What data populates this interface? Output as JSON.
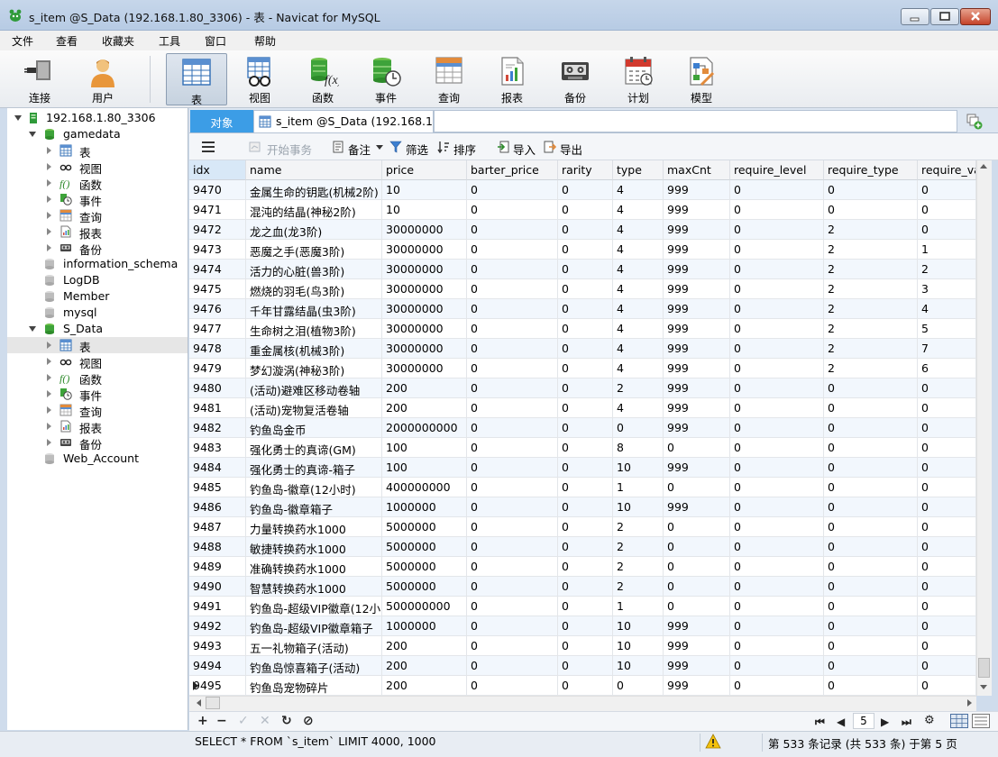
{
  "window": {
    "title": "s_item @S_Data (192.168.1.80_3306) - 表 - Navicat for MySQL"
  },
  "menu": [
    "文件",
    "查看",
    "收藏夹",
    "工具",
    "窗口",
    "帮助"
  ],
  "toolbar": {
    "connect": "连接",
    "user": "用户",
    "table": "表",
    "view": "视图",
    "function": "函数",
    "event": "事件",
    "query": "查询",
    "report": "报表",
    "backup": "备份",
    "schedule": "计划",
    "model": "模型"
  },
  "tree": {
    "connection": "192.168.1.80_3306",
    "gamedata": {
      "name": "gamedata",
      "children": [
        "表",
        "视图",
        "函数",
        "事件",
        "查询",
        "报表",
        "备份"
      ]
    },
    "databases": [
      "information_schema",
      "LogDB",
      "Member",
      "mysql"
    ],
    "s_data": {
      "name": "S_Data",
      "children": [
        "表",
        "视图",
        "函数",
        "事件",
        "查询",
        "报表",
        "备份"
      ]
    },
    "web_account": "Web_Account"
  },
  "tabs": {
    "objects": "对象",
    "item": "s_item @S_Data (192.168.1...."
  },
  "gridtoolbar": {
    "begin_tx": "开始事务",
    "memo": "备注",
    "filter": "筛选",
    "sort": "排序",
    "import": "导入",
    "export": "导出"
  },
  "columns": [
    "idx",
    "name",
    "price",
    "barter_price",
    "rarity",
    "type",
    "maxCnt",
    "require_level",
    "require_type",
    "require_va"
  ],
  "rows": [
    [
      "9470",
      "金属生命的钥匙(机械2阶)",
      "10",
      "0",
      "0",
      "4",
      "999",
      "0",
      "0",
      "0"
    ],
    [
      "9471",
      "混沌的结晶(神秘2阶)",
      "10",
      "0",
      "0",
      "4",
      "999",
      "0",
      "0",
      "0"
    ],
    [
      "9472",
      "龙之血(龙3阶)",
      "30000000",
      "0",
      "0",
      "4",
      "999",
      "0",
      "2",
      "0"
    ],
    [
      "9473",
      "恶魔之手(恶魔3阶)",
      "30000000",
      "0",
      "0",
      "4",
      "999",
      "0",
      "2",
      "1"
    ],
    [
      "9474",
      "活力的心脏(兽3阶)",
      "30000000",
      "0",
      "0",
      "4",
      "999",
      "0",
      "2",
      "2"
    ],
    [
      "9475",
      "燃烧的羽毛(鸟3阶)",
      "30000000",
      "0",
      "0",
      "4",
      "999",
      "0",
      "2",
      "3"
    ],
    [
      "9476",
      "千年甘露结晶(虫3阶)",
      "30000000",
      "0",
      "0",
      "4",
      "999",
      "0",
      "2",
      "4"
    ],
    [
      "9477",
      "生命树之泪(植物3阶)",
      "30000000",
      "0",
      "0",
      "4",
      "999",
      "0",
      "2",
      "5"
    ],
    [
      "9478",
      "重金属核(机械3阶)",
      "30000000",
      "0",
      "0",
      "4",
      "999",
      "0",
      "2",
      "7"
    ],
    [
      "9479",
      "梦幻漩涡(神秘3阶)",
      "30000000",
      "0",
      "0",
      "4",
      "999",
      "0",
      "2",
      "6"
    ],
    [
      "9480",
      "(活动)避难区移动卷轴",
      "200",
      "0",
      "0",
      "2",
      "999",
      "0",
      "0",
      "0"
    ],
    [
      "9481",
      "(活动)宠物复活卷轴",
      "200",
      "0",
      "0",
      "4",
      "999",
      "0",
      "0",
      "0"
    ],
    [
      "9482",
      "钓鱼岛金币",
      "2000000000",
      "0",
      "0",
      "0",
      "999",
      "0",
      "0",
      "0"
    ],
    [
      "9483",
      "强化勇士的真谛(GM)",
      "100",
      "0",
      "0",
      "8",
      "0",
      "0",
      "0",
      "0"
    ],
    [
      "9484",
      "强化勇士的真谛-箱子",
      "100",
      "0",
      "0",
      "10",
      "999",
      "0",
      "0",
      "0"
    ],
    [
      "9485",
      "钓鱼岛-徽章(12小时)",
      "400000000",
      "0",
      "0",
      "1",
      "0",
      "0",
      "0",
      "0"
    ],
    [
      "9486",
      "钓鱼岛-徽章箱子",
      "1000000",
      "0",
      "0",
      "10",
      "999",
      "0",
      "0",
      "0"
    ],
    [
      "9487",
      "力量转换药水1000",
      "5000000",
      "0",
      "0",
      "2",
      "0",
      "0",
      "0",
      "0"
    ],
    [
      "9488",
      "敏捷转换药水1000",
      "5000000",
      "0",
      "0",
      "2",
      "0",
      "0",
      "0",
      "0"
    ],
    [
      "9489",
      "准确转换药水1000",
      "5000000",
      "0",
      "0",
      "2",
      "0",
      "0",
      "0",
      "0"
    ],
    [
      "9490",
      "智慧转换药水1000",
      "5000000",
      "0",
      "0",
      "2",
      "0",
      "0",
      "0",
      "0"
    ],
    [
      "9491",
      "钓鱼岛-超级VIP徽章(12小时)",
      "500000000",
      "0",
      "0",
      "1",
      "0",
      "0",
      "0",
      "0"
    ],
    [
      "9492",
      "钓鱼岛-超级VIP徽章箱子",
      "1000000",
      "0",
      "0",
      "10",
      "999",
      "0",
      "0",
      "0"
    ],
    [
      "9493",
      "五一礼物箱子(活动)",
      "200",
      "0",
      "0",
      "10",
      "999",
      "0",
      "0",
      "0"
    ],
    [
      "9494",
      "钓鱼岛惊喜箱子(活动)",
      "200",
      "0",
      "0",
      "10",
      "999",
      "0",
      "0",
      "0"
    ],
    [
      "9495",
      "钓鱼岛宠物碎片",
      "200",
      "0",
      "0",
      "0",
      "999",
      "0",
      "0",
      "0"
    ]
  ],
  "navbar": {
    "page": "5"
  },
  "status": {
    "sql": "SELECT * FROM `s_item` LIMIT 4000, 1000",
    "records": "第 533 条记录 (共 533 条) 于第 5 页"
  },
  "colors": {
    "accent": "#3c9de6",
    "title_bar": "#c6d6ea",
    "close": "#c4432a"
  }
}
